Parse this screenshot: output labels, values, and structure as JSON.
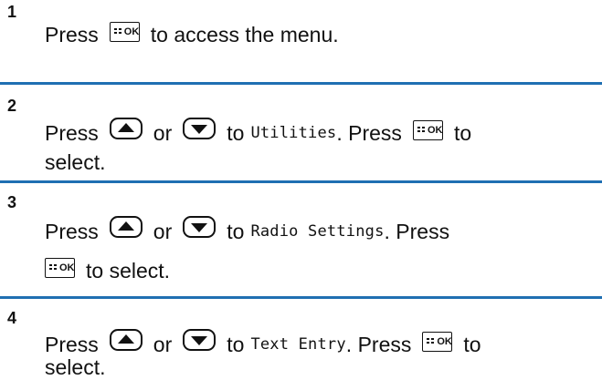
{
  "colors": {
    "divider": "#1f6fb2",
    "text": "#111111"
  },
  "icons": {
    "ok": "menu-ok-key-icon",
    "up": "up-arrow-key-icon",
    "down": "down-arrow-key-icon"
  },
  "ok_key_label": "OK",
  "steps": [
    {
      "number": "1",
      "w_press": "Press",
      "w_after": "to access the menu."
    },
    {
      "number": "2",
      "w_press": "Press",
      "w_or": "or",
      "w_to": "to",
      "menu_item": "Utilities",
      "w_press2": ". Press",
      "w_to2": "to",
      "w_select": "select."
    },
    {
      "number": "3",
      "w_press": "Press",
      "w_or": "or",
      "w_to": "to",
      "menu_item": "Radio Settings",
      "w_press2": ". Press",
      "w_select": "to select."
    },
    {
      "number": "4",
      "w_press": "Press",
      "w_or": "or",
      "w_to": "to",
      "menu_item": "Text Entry",
      "w_press2": ". Press",
      "w_to2": "to",
      "w_select": "select."
    }
  ]
}
